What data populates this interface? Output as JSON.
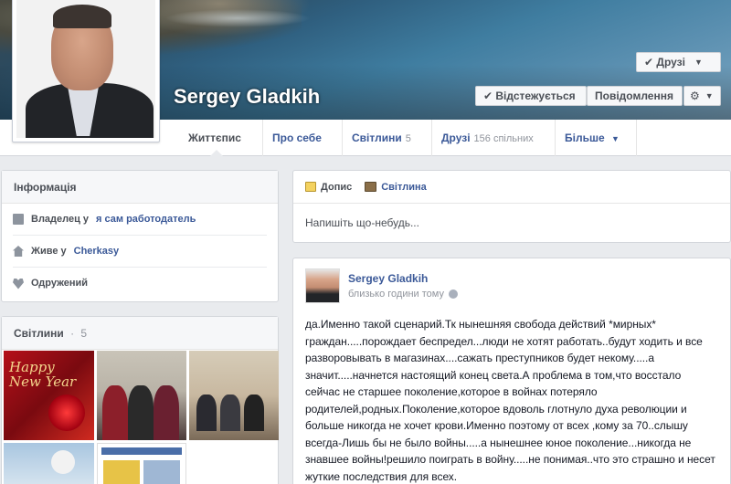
{
  "profile": {
    "name": "Sergey Gladkih"
  },
  "actions": {
    "friends_label": "✔ Друзі",
    "following_label": "✔ Відстежується",
    "message_label": "Повідомлення",
    "gear_symbol": "⚙"
  },
  "tabs": [
    {
      "label": "Життєпис",
      "count": ""
    },
    {
      "label": "Про себе",
      "count": ""
    },
    {
      "label": "Світлини",
      "count": "5"
    },
    {
      "label": "Друзі",
      "count": "156 спільних"
    },
    {
      "label": "Більше",
      "count": ""
    }
  ],
  "info": {
    "title": "Інформація",
    "work_prefix": "Владелец у",
    "work_value": "я сам работодатель",
    "lives_prefix": "Живе у",
    "lives_value": "Cherkasy",
    "relationship": "Одружений"
  },
  "photos": {
    "title": "Світлини",
    "separator": "·",
    "count": "5",
    "greeting_line1": "Happy",
    "greeting_line2": "New Year"
  },
  "composer": {
    "status_tab": "Допис",
    "photo_tab": "Світлина",
    "placeholder": "Напишіть що-небудь..."
  },
  "post": {
    "author": "Sergey Gladkih",
    "time": "близько години тому",
    "text": "да.Именно такой сценарий.Тк нынешняя свобода действий *мирных* граждан.....порождает беспредел...люди не хотят работать..будут ходить и все разворовывать в магазинах....сажать преступников будет некому.....а значит.....начнется настоящий конец света.А проблема в том,что восстало сейчас не старшее поколение,которое в войнах потеряло родителей,родных.Поколение,которое вдоволь глотнуло духа революции и больше никогда не хочет крови.Именно поэтому от всех ,кому за 70..слышу всегда-Лишь бы не было войны.....а нынешнее юное поколение...никогда не знавшее войны!решило поиграть в войну.....не понимая..что это страшно и несет жуткие последствия для всех."
  },
  "colors": {
    "link": "#3b5998",
    "background": "#e9ebee",
    "muted": "#90949c"
  }
}
